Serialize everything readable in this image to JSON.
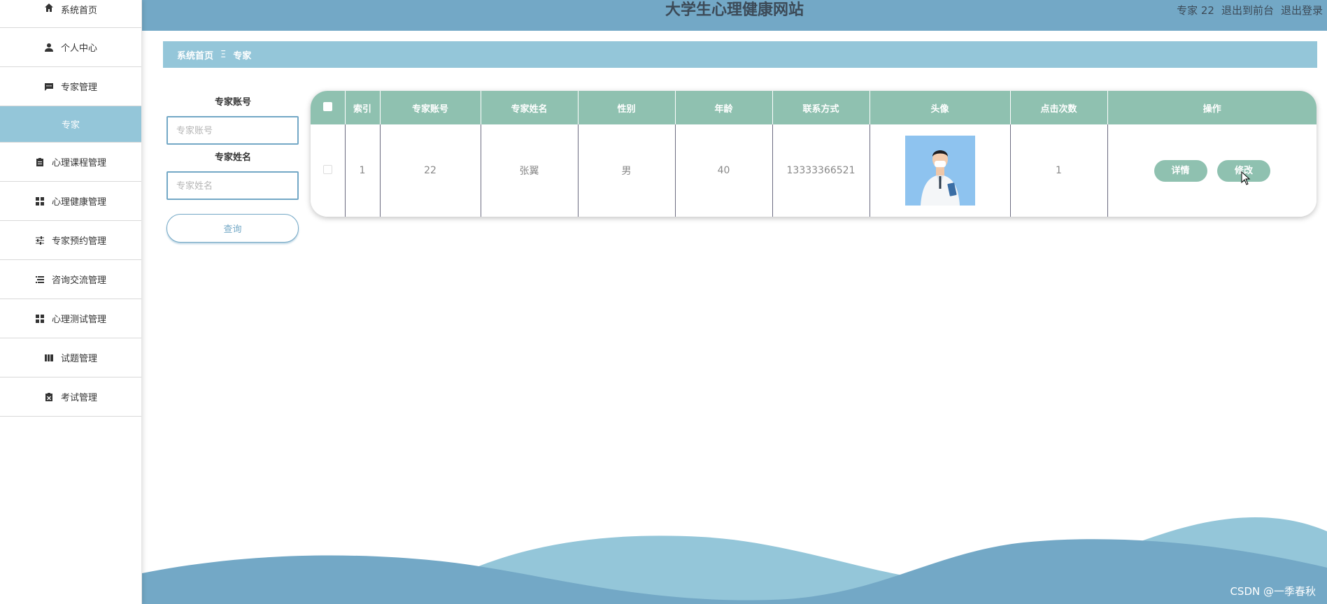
{
  "header": {
    "title": "大学生心理健康网站",
    "user": "专家 22",
    "to_front": "退出到前台",
    "logout": "退出登录"
  },
  "sidebar": {
    "items": [
      {
        "label": "系统首页",
        "icon": "home-icon"
      },
      {
        "label": "个人中心",
        "icon": "user-icon"
      },
      {
        "label": "专家管理",
        "icon": "chat-icon"
      },
      {
        "label": "专家",
        "icon": ""
      },
      {
        "label": "心理课程管理",
        "icon": "clipboard-icon"
      },
      {
        "label": "心理健康管理",
        "icon": "grid-icon"
      },
      {
        "label": "专家预约管理",
        "icon": "sliders-icon"
      },
      {
        "label": "咨询交流管理",
        "icon": "list-icon"
      },
      {
        "label": "心理测试管理",
        "icon": "grid-icon"
      },
      {
        "label": "试题管理",
        "icon": "book-icon"
      },
      {
        "label": "考试管理",
        "icon": "clipboard-x-icon"
      }
    ],
    "active_sub": "专家"
  },
  "breadcrumb": {
    "home": "系统首页",
    "separator": "Ξ",
    "current": "专家"
  },
  "search": {
    "account_label": "专家账号",
    "account_placeholder": "专家账号",
    "name_label": "专家姓名",
    "name_placeholder": "专家姓名",
    "query_button": "查询"
  },
  "table": {
    "columns": [
      "",
      "索引",
      "专家账号",
      "专家姓名",
      "性别",
      "年龄",
      "联系方式",
      "头像",
      "点击次数",
      "操作"
    ],
    "rows": [
      {
        "index": "1",
        "account": "22",
        "name": "张翼",
        "gender": "男",
        "age": "40",
        "phone": "13333366521",
        "clicks": "1",
        "actions": [
          "详情",
          "修改"
        ]
      }
    ]
  },
  "colors": {
    "header_bg": "#73a8c6",
    "breadcrumb_bg": "#94c6d9",
    "table_header_bg": "#8fc1b0",
    "wave_light": "#94c6d9",
    "wave_dark": "#73a8c6"
  },
  "watermark": "CSDN @一季春秋"
}
